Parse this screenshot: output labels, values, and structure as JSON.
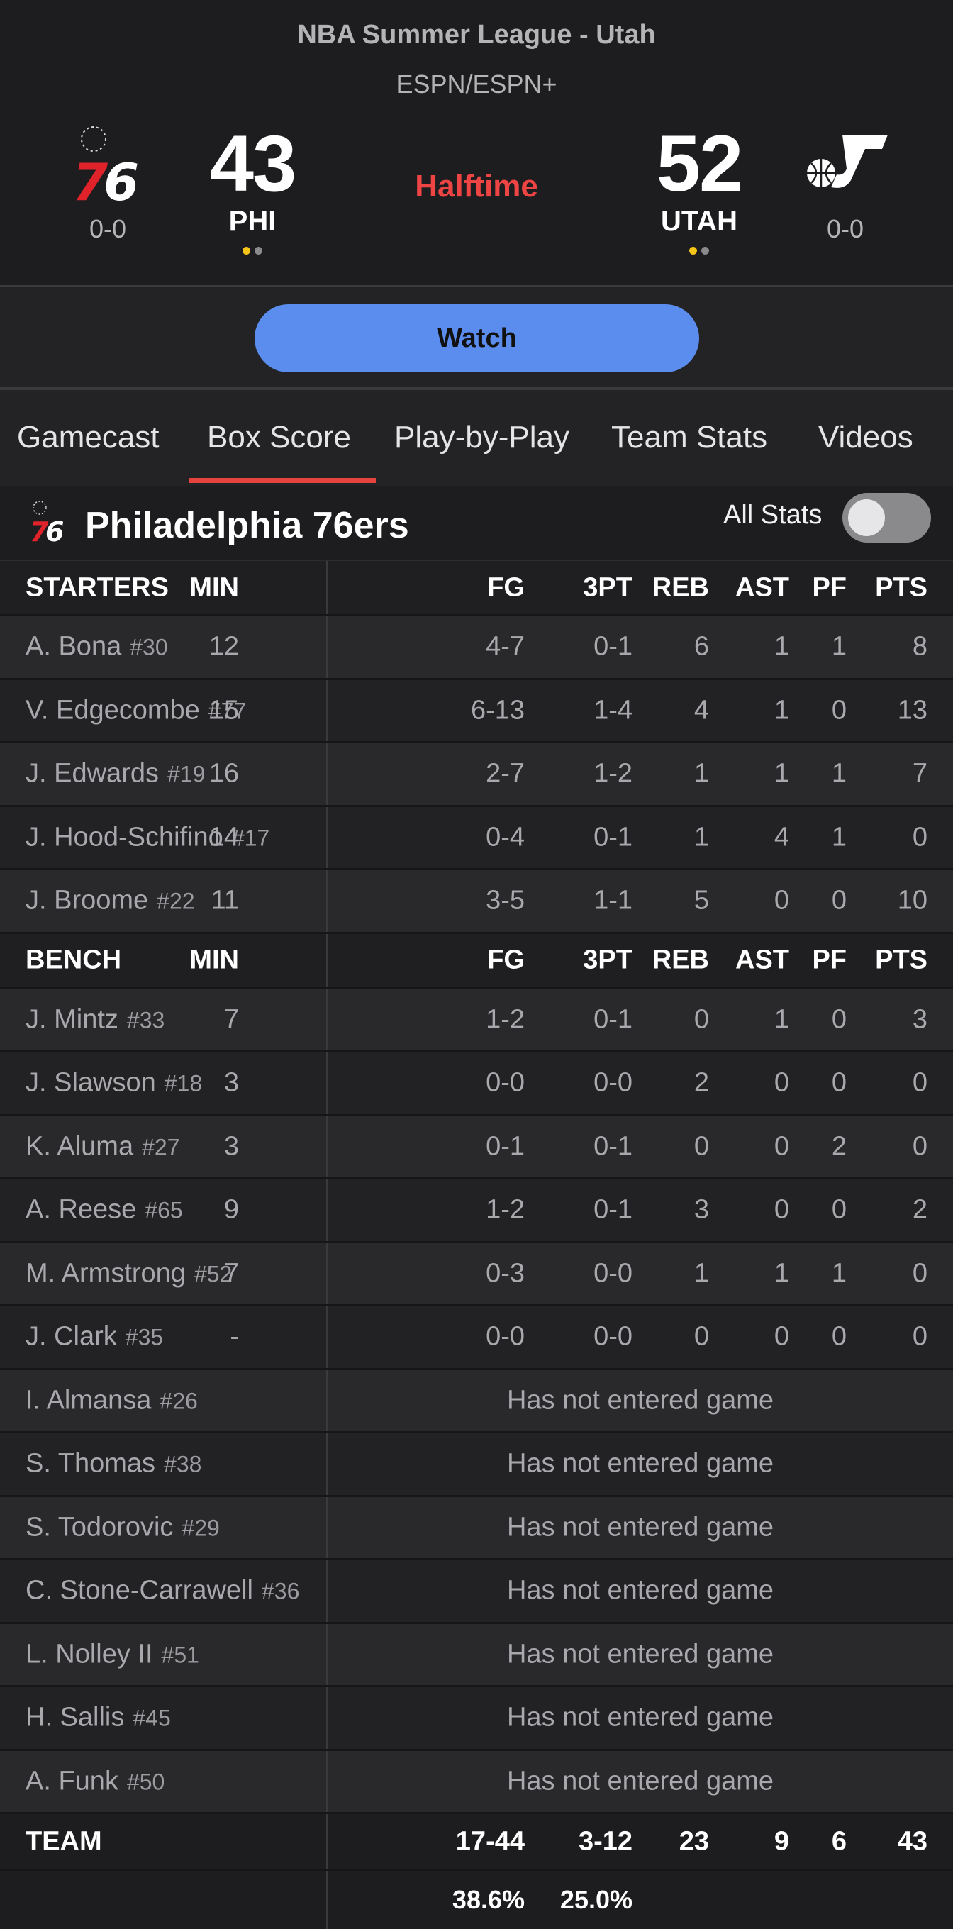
{
  "header": {
    "league": "NBA Summer League - Utah",
    "network": "ESPN/ESPN+",
    "status": "Halftime",
    "away": {
      "abbr": "PHI",
      "score": "43",
      "record": "0-0",
      "logo": "76ers-logo",
      "timeouts_color": "#f5c518"
    },
    "home": {
      "abbr": "UTAH",
      "score": "52",
      "record": "0-0",
      "logo": "jazz-logo",
      "timeouts_color": "#f5c518"
    }
  },
  "watch": {
    "label": "Watch"
  },
  "tabs": [
    "Gamecast",
    "Box Score",
    "Play-by-Play",
    "Team Stats",
    "Videos"
  ],
  "active_tab": "Box Score",
  "team_bar": {
    "name": "Philadelphia 76ers",
    "all_stats_label": "All Stats",
    "all_stats_on": false
  },
  "columns": [
    "MIN",
    "FG",
    "3PT",
    "REB",
    "AST",
    "PF",
    "PTS"
  ],
  "starters_label": "STARTERS",
  "bench_label": "BENCH",
  "starters": [
    {
      "name": "A. Bona",
      "num": "#30",
      "stats": [
        "12",
        "4-7",
        "0-1",
        "6",
        "1",
        "1",
        "8"
      ]
    },
    {
      "name": "V. Edgecombe",
      "num": "#77",
      "stats": [
        "15",
        "6-13",
        "1-4",
        "4",
        "1",
        "0",
        "13"
      ]
    },
    {
      "name": "J. Edwards",
      "num": "#19",
      "stats": [
        "16",
        "2-7",
        "1-2",
        "1",
        "1",
        "1",
        "7"
      ]
    },
    {
      "name": "J. Hood-Schifino",
      "num": "#17",
      "stats": [
        "14",
        "0-4",
        "0-1",
        "1",
        "4",
        "1",
        "0"
      ]
    },
    {
      "name": "J. Broome",
      "num": "#22",
      "stats": [
        "11",
        "3-5",
        "1-1",
        "5",
        "0",
        "0",
        "10"
      ]
    }
  ],
  "bench": [
    {
      "name": "J. Mintz",
      "num": "#33",
      "stats": [
        "7",
        "1-2",
        "0-1",
        "0",
        "1",
        "0",
        "3"
      ]
    },
    {
      "name": "J. Slawson",
      "num": "#18",
      "stats": [
        "3",
        "0-0",
        "0-0",
        "2",
        "0",
        "0",
        "0"
      ]
    },
    {
      "name": "K. Aluma",
      "num": "#27",
      "stats": [
        "3",
        "0-1",
        "0-1",
        "0",
        "0",
        "2",
        "0"
      ]
    },
    {
      "name": "A. Reese",
      "num": "#65",
      "stats": [
        "9",
        "1-2",
        "0-1",
        "3",
        "0",
        "0",
        "2"
      ]
    },
    {
      "name": "M. Armstrong",
      "num": "#52",
      "stats": [
        "7",
        "0-3",
        "0-0",
        "1",
        "1",
        "1",
        "0"
      ]
    },
    {
      "name": "J. Clark",
      "num": "#35",
      "stats": [
        "-",
        "0-0",
        "0-0",
        "0",
        "0",
        "0",
        "0"
      ]
    },
    {
      "name": "I. Almansa",
      "num": "#26",
      "dnp": "Has not entered game"
    },
    {
      "name": "S. Thomas",
      "num": "#38",
      "dnp": "Has not entered game"
    },
    {
      "name": "S. Todorovic",
      "num": "#29",
      "dnp": "Has not entered game"
    },
    {
      "name": "C. Stone-Carrawell",
      "num": "#36",
      "dnp": "Has not entered game"
    },
    {
      "name": "L. Nolley II",
      "num": "#51",
      "dnp": "Has not entered game"
    },
    {
      "name": "H. Sallis",
      "num": "#45",
      "dnp": "Has not entered game"
    },
    {
      "name": "A. Funk",
      "num": "#50",
      "dnp": "Has not entered game"
    }
  ],
  "team_totals": {
    "label": "TEAM",
    "stats": [
      "",
      "17-44",
      "3-12",
      "23",
      "9",
      "6",
      "43"
    ],
    "pct": [
      "",
      "38.6%",
      "25.0%",
      "",
      "",
      "",
      ""
    ]
  }
}
